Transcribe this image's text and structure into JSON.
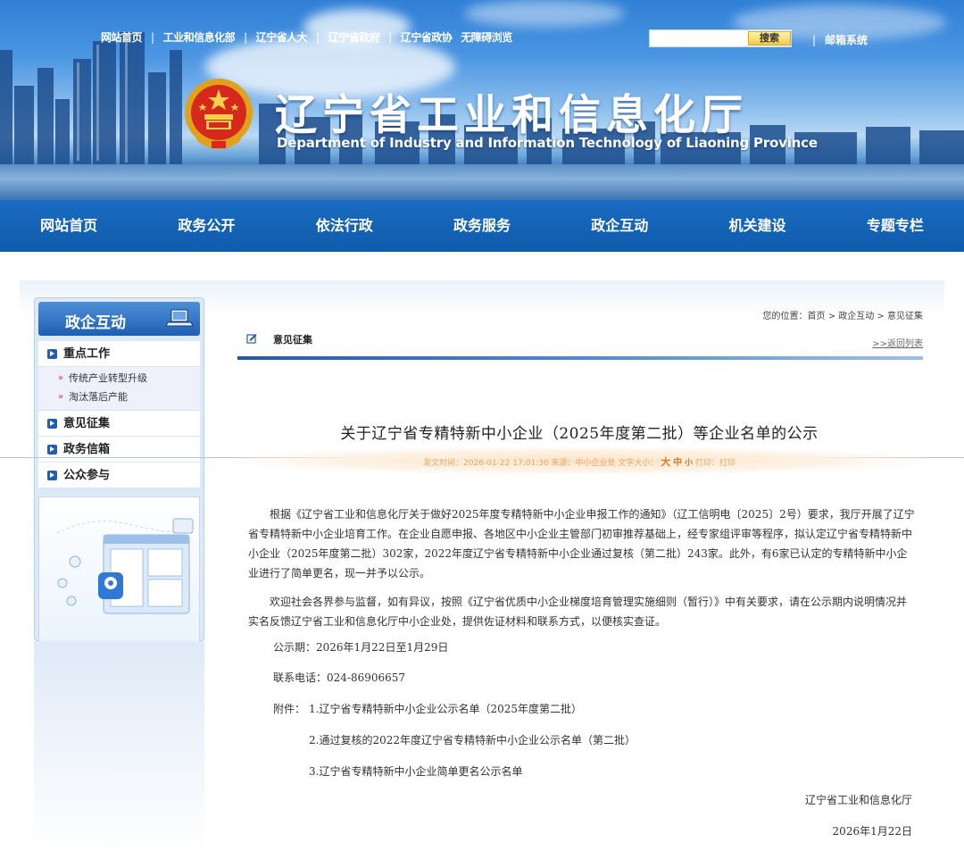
{
  "top_links": [
    "网站首页",
    "工业和信息化部",
    "辽宁省人大",
    "辽宁省政府",
    "辽宁省政协",
    "无障碍浏览"
  ],
  "search_button": "搜索",
  "mail_link": "邮箱系统",
  "site": {
    "title": "辽宁省工业和信息化厅",
    "subtitle": "Department of Industry and Information Technology of Liaoning Province"
  },
  "nav": [
    "网站首页",
    "政务公开",
    "依法行政",
    "政务服务",
    "政企互动",
    "机关建设",
    "专题专栏"
  ],
  "sidebar": {
    "title": "政企互动",
    "items": [
      {
        "label": "重点工作",
        "subs": [
          "传统产业转型升级",
          "淘汰落后产能"
        ]
      },
      {
        "label": "意见征集"
      },
      {
        "label": "政务信箱"
      },
      {
        "label": "公众参与"
      }
    ]
  },
  "breadcrumb": "您的位置：首页 > 政企互动 > 意见征集",
  "section": {
    "title": "意见征集",
    "back": ">>返回列表"
  },
  "article": {
    "title": "关于辽宁省专精特新中小企业（2025年度第二批）等企业名单的公示",
    "meta_prefix": "发文时间：2026-01-22  17:01:30  来源：中小企业处  文字大小：",
    "size_large": "大",
    "size_medium": "中",
    "size_small": "小",
    "meta_print": "  打印：打印",
    "paragraphs": [
      "根据《辽宁省工业和信息化厅关于做好2025年度专精特新中小企业申报工作的通知》（辽工信明电〔2025〕2号）要求，我厅开展了辽宁省专精特新中小企业培育工作。在企业自愿申报、各地区中小企业主管部门初审推荐基础上，经专家组评审等程序，拟认定辽宁省专精特新中小企业（2025年度第二批）302家，2022年度辽宁省专精特新中小企业通过复核（第二批）243家。此外，有6家已认定的专精特新中小企业进行了简单更名，现一并予以公示。",
      "欢迎社会各界参与监督，如有异议，按照《辽宁省优质中小企业梯度培育管理实施细则（暂行）》中有关要求，请在公示期内说明情况并实名反馈辽宁省工业和信息化厅中小企业处，提供佐证材料和联系方式，以便核实查证。"
    ],
    "period": "公示期：2026年1月22日至1月29日",
    "phone": "联系电话：024-86906657",
    "attachments_label": "附件：",
    "attachments": [
      "1.辽宁省专精特新中小企业公示名单（2025年度第二批）",
      "2.通过复核的2022年度辽宁省专精特新中小企业公示名单（第二批）",
      "3.辽宁省专精特新中小企业简单更名公示名单"
    ],
    "signature": "辽宁省工业和信息化厅",
    "date": "2026年1月22日"
  }
}
